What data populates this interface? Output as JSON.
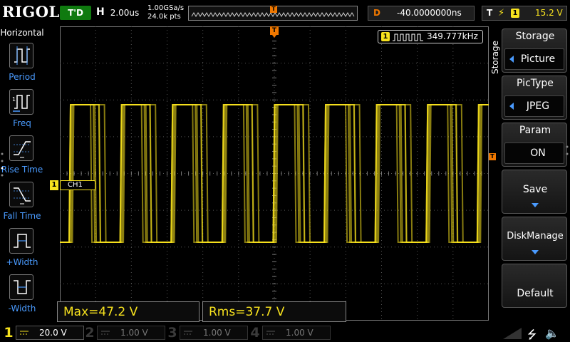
{
  "header": {
    "brand": "RIGOL",
    "run_state": "T'D",
    "horizontal_label": "H",
    "timebase": "2.00us",
    "sample_rate": "1.00GSa/s",
    "memory_depth": "24.0k pts",
    "delay_label": "D",
    "delay": "-40.0000000ns",
    "trigger_label": "T",
    "trigger_source": "1",
    "trigger_level": "15.2 V"
  },
  "left_menu": {
    "title": "Horizontal",
    "items": [
      {
        "label": "Period",
        "icon": "period-icon"
      },
      {
        "label": "Freq",
        "icon": "frequency-icon"
      },
      {
        "label": "Rise Time",
        "icon": "rise-time-icon"
      },
      {
        "label": "Fall Time",
        "icon": "fall-time-icon"
      },
      {
        "label": "+Width",
        "icon": "positive-width-icon"
      },
      {
        "label": "-Width",
        "icon": "negative-width-icon"
      }
    ]
  },
  "scope": {
    "trigger_marker": "T",
    "frequency_channel": "1",
    "frequency": "349.777kHz",
    "ch1_marker_num": "1",
    "ch1_marker_label": "CH1"
  },
  "measurements": {
    "max": "Max=47.2 V",
    "rms": "Rms=37.7 V"
  },
  "right_menu": {
    "vertical_title": "Storage",
    "buttons": [
      {
        "title": "Storage",
        "value": "Picture"
      },
      {
        "title": "PicType",
        "value": "JPEG"
      },
      {
        "title": "Param",
        "value": "ON"
      },
      {
        "title": "Save"
      },
      {
        "title": "DiskManage"
      },
      {
        "title": "Default"
      }
    ]
  },
  "channels": [
    {
      "num": "1",
      "scale": "20.0 V",
      "color": "#f7e21e",
      "active": true
    },
    {
      "num": "2",
      "scale": "1.00 V",
      "color": "#00a0c8",
      "active": false
    },
    {
      "num": "3",
      "scale": "1.00 V",
      "color": "#c030c0",
      "active": false
    },
    {
      "num": "4",
      "scale": "1.00 V",
      "color": "#3a6fd8",
      "active": false
    }
  ],
  "colors": {
    "ch1": "#f7e21e",
    "trigger": "#f07800",
    "menu_accent": "#4a9bff",
    "run_state_bg": "#0f7a0f"
  },
  "status_icons": [
    "usb-icon",
    "speaker-icon"
  ]
}
